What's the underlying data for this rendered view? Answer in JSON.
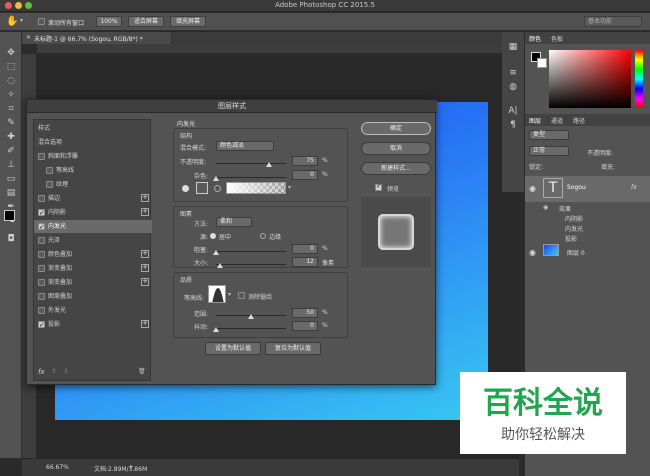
{
  "app": {
    "title": "Adobe Photoshop CC 2015.5"
  },
  "options_bar": {
    "scroll_all_label": "滚动所有窗口",
    "zoom_100": "100%",
    "fit_screen": "适合屏幕",
    "fill_screen": "填充屏幕",
    "workspace": "基本功能"
  },
  "document": {
    "tab_title": "未标题-1 @ 66.7% (Sogou, RGB/8*) *",
    "zoom": "66.67%",
    "doc_size": "文档:2.89M/3.86M"
  },
  "panels": {
    "color_tabs": [
      "颜色",
      "色板"
    ],
    "layer_tabs": [
      "图层",
      "通道",
      "路径"
    ],
    "kind_label": "类型",
    "blend_mode": "正常",
    "opacity_label": "不透明度:",
    "lock_label": "锁定:",
    "fill_label": "填充:",
    "layers": [
      {
        "name": "Sogou",
        "fx": "fx"
      },
      {
        "name": "图层 0"
      }
    ],
    "effects_label": "效果",
    "effects": [
      "内阴影",
      "内发光",
      "投影"
    ]
  },
  "dialog": {
    "title": "图层样式",
    "styles_header": "样式",
    "blend_options": "混合选项",
    "style_items": [
      {
        "label": "斜面和浮雕",
        "checked": false,
        "plus": false
      },
      {
        "label": "等高线",
        "checked": false,
        "plus": false,
        "indent": true
      },
      {
        "label": "纹理",
        "checked": false,
        "plus": false,
        "indent": true
      },
      {
        "label": "描边",
        "checked": false,
        "plus": true
      },
      {
        "label": "内阴影",
        "checked": true,
        "plus": true
      },
      {
        "label": "内发光",
        "checked": true,
        "plus": false,
        "selected": true
      },
      {
        "label": "光泽",
        "checked": false,
        "plus": false
      },
      {
        "label": "颜色叠加",
        "checked": false,
        "plus": true
      },
      {
        "label": "渐变叠加",
        "checked": false,
        "plus": true
      },
      {
        "label": "渐变叠加",
        "checked": false,
        "plus": true
      },
      {
        "label": "图案叠加",
        "checked": false,
        "plus": false
      },
      {
        "label": "外发光",
        "checked": false,
        "plus": false
      },
      {
        "label": "投影",
        "checked": true,
        "plus": true
      }
    ],
    "fx_label": "fx",
    "section_title": "内发光",
    "structure": {
      "title": "结构",
      "blend_mode_label": "混合模式:",
      "blend_mode": "颜色减淡",
      "opacity_label": "不透明度:",
      "opacity": "75",
      "noise_label": "杂色:",
      "noise": "0",
      "unit": "%"
    },
    "elements": {
      "title": "图素",
      "method_label": "方法:",
      "method": "柔和",
      "source_label": "源:",
      "center": "居中",
      "edge": "边缘",
      "choke_label": "阻塞:",
      "choke": "0",
      "size_label": "大小:",
      "size": "12",
      "unit_pct": "%",
      "unit_px": "像素"
    },
    "quality": {
      "title": "品质",
      "contour_label": "等高线:",
      "antialias": "消除锯齿",
      "range_label": "范围:",
      "range": "50",
      "jitter_label": "抖动:",
      "jitter": "0",
      "unit": "%"
    },
    "make_default": "设置为默认值",
    "reset_default": "复位为默认值",
    "ok": "确定",
    "cancel": "取消",
    "new_style": "新建样式...",
    "preview": "预览"
  },
  "watermark": {
    "title": "百科全说",
    "subtitle": "助你轻松解决"
  },
  "progress": {
    "opacity_fraction": 0.75,
    "noise_fraction": 0.0,
    "choke_fraction": 0.0,
    "size_fraction": 0.05,
    "range_fraction": 0.5,
    "jitter_fraction": 0.0
  }
}
